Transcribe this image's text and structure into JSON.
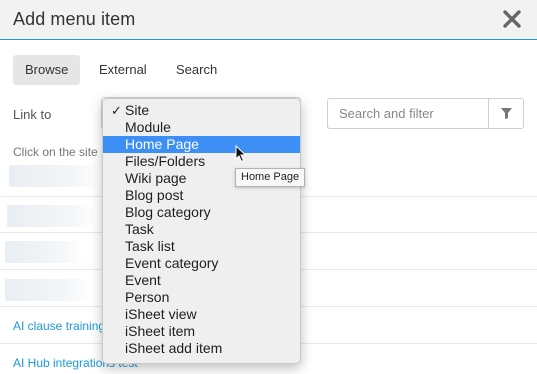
{
  "dialog": {
    "title": "Add menu item",
    "close_icon": "close-icon"
  },
  "tabs": [
    {
      "label": "Browse",
      "active": true
    },
    {
      "label": "External",
      "active": false
    },
    {
      "label": "Search",
      "active": false
    }
  ],
  "link_to": {
    "label": "Link to",
    "selected": "Site"
  },
  "filter": {
    "placeholder": "Search and filter",
    "value": "",
    "icon": "funnel-icon"
  },
  "hint": "Click on the site",
  "links": [
    "AI clause training",
    "AI Hub integrations test"
  ],
  "dropdown": {
    "options": [
      "Site",
      "Module",
      "Home Page",
      "Files/Folders",
      "Wiki page",
      "Blog post",
      "Blog category",
      "Task",
      "Task list",
      "Event category",
      "Event",
      "Person",
      "iSheet view",
      "iSheet item",
      "iSheet add item"
    ],
    "checked": "Site",
    "highlighted": "Home Page",
    "check_mark": "✓"
  },
  "tooltip": "Home Page",
  "colors": {
    "accent": "#1a9ad6",
    "highlight": "#3d8ff5"
  }
}
